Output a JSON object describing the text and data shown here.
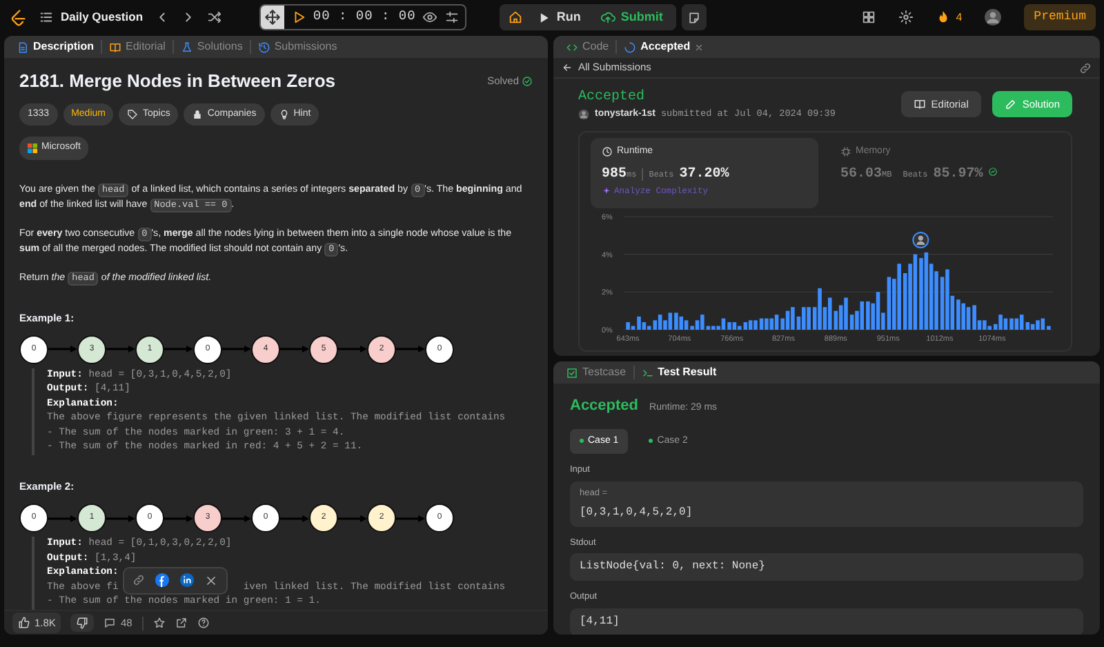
{
  "top_bar": {
    "title": "Daily Question",
    "timer": "00 : 00 : 00",
    "run": "Run",
    "submit": "Submit",
    "streak": "4",
    "premium": "Premium"
  },
  "problem": {
    "tabs": [
      {
        "label": "Description",
        "selected": true
      },
      {
        "label": "Editorial",
        "selected": false
      },
      {
        "label": "Solutions",
        "selected": false
      },
      {
        "label": "Submissions",
        "selected": false
      }
    ],
    "title": "2181. Merge Nodes in Between Zeros",
    "status": "Solved",
    "chips": [
      {
        "label": "1333",
        "kind": "plain"
      },
      {
        "label": "Medium",
        "kind": "difficulty"
      },
      {
        "label": "Topics",
        "kind": "tag"
      },
      {
        "label": "Companies",
        "kind": "lock"
      },
      {
        "label": "Hint",
        "kind": "bulb"
      }
    ],
    "company": "Microsoft",
    "paragraphs": [
      [
        {
          "kind": "plain",
          "text": "You are given the "
        },
        {
          "kind": "code",
          "text": "head"
        },
        {
          "kind": "plain",
          "text": " of a linked list, which contains a series of integers "
        },
        {
          "kind": "bold",
          "text": "separated"
        },
        {
          "kind": "plain",
          "text": " by "
        },
        {
          "kind": "code",
          "text": "0"
        },
        {
          "kind": "plain",
          "text": "'s. The "
        },
        {
          "kind": "bold",
          "text": "beginning"
        },
        {
          "kind": "plain",
          "text": " and "
        },
        {
          "kind": "bold",
          "text": "end"
        },
        {
          "kind": "plain",
          "text": " of the linked list will have "
        },
        {
          "kind": "code",
          "text": "Node.val == 0"
        },
        {
          "kind": "plain",
          "text": "."
        }
      ],
      [
        {
          "kind": "plain",
          "text": "For "
        },
        {
          "kind": "bold",
          "text": "every"
        },
        {
          "kind": "plain",
          "text": " two consecutive "
        },
        {
          "kind": "code",
          "text": "0"
        },
        {
          "kind": "plain",
          "text": "'s, "
        },
        {
          "kind": "bold",
          "text": "merge"
        },
        {
          "kind": "plain",
          "text": " all the nodes lying in between them into a single node whose value is the "
        },
        {
          "kind": "bold",
          "text": "sum"
        },
        {
          "kind": "plain",
          "text": " of all the merged nodes. The modified list should not contain any "
        },
        {
          "kind": "code",
          "text": "0"
        },
        {
          "kind": "plain",
          "text": "'s."
        }
      ],
      [
        {
          "kind": "plain",
          "text": "Return "
        },
        {
          "kind": "italic",
          "text": "the "
        },
        {
          "kind": "code",
          "text": "head"
        },
        {
          "kind": "italic",
          "text": " of the modified linked list."
        }
      ]
    ],
    "examples": [
      {
        "title": "Example 1:",
        "nodes": [
          {
            "value": "0",
            "color": "#ffffff"
          },
          {
            "value": "3",
            "color": "#d5e8d4"
          },
          {
            "value": "1",
            "color": "#d5e8d4"
          },
          {
            "value": "0",
            "color": "#ffffff"
          },
          {
            "value": "4",
            "color": "#f8cecc"
          },
          {
            "value": "5",
            "color": "#f8cecc"
          },
          {
            "value": "2",
            "color": "#f8cecc"
          },
          {
            "value": "0",
            "color": "#ffffff"
          }
        ],
        "io": [
          {
            "label": "Input:",
            "value": "head = [0,3,1,0,4,5,2,0]"
          },
          {
            "label": "Output:",
            "value": "[4,11]"
          }
        ],
        "explanation_label": "Explanation:",
        "explanation": [
          [
            "The above figure represents the given linked list. The modified list contains"
          ],
          [
            "- The sum of the nodes marked in green: 3 + 1 = 4."
          ],
          [
            "- The sum of the nodes marked in red: 4 + 5 + 2 = 11."
          ]
        ]
      },
      {
        "title": "Example 2:",
        "nodes": [
          {
            "value": "0",
            "color": "#ffffff"
          },
          {
            "value": "1",
            "color": "#d5e8d4"
          },
          {
            "value": "0",
            "color": "#ffffff"
          },
          {
            "value": "3",
            "color": "#f8cecc"
          },
          {
            "value": "0",
            "color": "#ffffff"
          },
          {
            "value": "2",
            "color": "#fff2cc"
          },
          {
            "value": "2",
            "color": "#fff2cc"
          },
          {
            "value": "0",
            "color": "#ffffff"
          }
        ],
        "io": [
          {
            "label": "Input:",
            "value": "head = [0,1,0,3,0,2,2,0]"
          },
          {
            "label": "Output:",
            "value": "[1,3,4]"
          }
        ],
        "explanation_label": "Explanation:",
        "explanation": [
          [
            "The above fi",
            "iven linked list. The modified list contains"
          ],
          [
            "- The sum of the nodes marked in green: 1 = 1."
          ]
        ]
      }
    ],
    "footer": {
      "likes": "1.8K",
      "comments": "48"
    }
  },
  "submission": {
    "tabs": [
      {
        "label": "Code",
        "selected": false,
        "closable": false
      },
      {
        "label": "Accepted",
        "selected": true,
        "closable": true
      }
    ],
    "back_link": "All Submissions",
    "status": "Accepted",
    "user": "tonystark-1st",
    "submitted": "submitted at Jul 04, 2024 09:39",
    "buttons": [
      {
        "label": "Editorial",
        "kind": "secondary"
      },
      {
        "label": "Solution",
        "kind": "primary"
      }
    ],
    "stats": [
      {
        "title": "Runtime",
        "selected": true,
        "value": "985",
        "unit": "ms",
        "beats_label": "Beats",
        "beats": "37.20%",
        "badge": false,
        "extra": "Analyze Complexity"
      },
      {
        "title": "Memory",
        "selected": false,
        "value": "56.03",
        "unit": "MB",
        "beats_label": "Beats",
        "beats": "85.97%",
        "badge": true
      }
    ],
    "chart_data": {
      "type": "bar",
      "ylim": [
        0,
        6
      ],
      "xlim": [
        638,
        1146
      ],
      "yticks": [
        {
          "value": 0,
          "label": "0%"
        },
        {
          "value": 2,
          "label": "2%"
        },
        {
          "value": 4,
          "label": "4%"
        },
        {
          "value": 6,
          "label": "6%"
        }
      ],
      "xticks": [
        {
          "value": 643,
          "label": "643ms"
        },
        {
          "value": 704,
          "label": "704ms"
        },
        {
          "value": 766,
          "label": "766ms"
        },
        {
          "value": 827,
          "label": "827ms"
        },
        {
          "value": 889,
          "label": "889ms"
        },
        {
          "value": 951,
          "label": "951ms"
        },
        {
          "value": 1012,
          "label": "1012ms"
        },
        {
          "value": 1074,
          "label": "1074ms"
        }
      ],
      "x": [
        643,
        649,
        656,
        662,
        668,
        675,
        681,
        687,
        693,
        700,
        706,
        712,
        719,
        725,
        731,
        738,
        744,
        750,
        756,
        763,
        769,
        775,
        782,
        788,
        794,
        801,
        807,
        813,
        819,
        826,
        832,
        838,
        845,
        851,
        857,
        864,
        870,
        876,
        882,
        889,
        895,
        901,
        908,
        914,
        920,
        927,
        933,
        939,
        945,
        952,
        958,
        964,
        971,
        977,
        983,
        990,
        996,
        1002,
        1008,
        1015,
        1021,
        1027,
        1034,
        1040,
        1046,
        1053,
        1059,
        1065,
        1071,
        1078,
        1084,
        1090,
        1097,
        1103,
        1109,
        1116,
        1122,
        1128,
        1134,
        1141
      ],
      "values": [
        0.4,
        0.2,
        0.7,
        0.4,
        0.2,
        0.5,
        0.8,
        0.5,
        0.9,
        0.9,
        0.7,
        0.5,
        0.2,
        0.5,
        0.8,
        0.2,
        0.2,
        0.2,
        0.6,
        0.4,
        0.4,
        0.2,
        0.4,
        0.5,
        0.5,
        0.6,
        0.6,
        0.6,
        0.8,
        0.6,
        1.0,
        1.2,
        0.7,
        1.2,
        1.2,
        1.2,
        2.2,
        1.2,
        1.7,
        1.0,
        1.3,
        1.7,
        0.8,
        1.0,
        1.5,
        1.5,
        1.4,
        2.0,
        0.9,
        2.8,
        2.7,
        3.5,
        3.0,
        3.5,
        4.0,
        3.8,
        4.1,
        3.5,
        3.1,
        2.8,
        3.2,
        1.8,
        1.6,
        1.4,
        1.2,
        1.3,
        0.5,
        0.5,
        0.2,
        0.3,
        0.8,
        0.6,
        0.6,
        0.6,
        0.8,
        0.4,
        0.3,
        0.5,
        0.6,
        0.2
      ]
    }
  },
  "result": {
    "tabs": [
      {
        "label": "Testcase",
        "selected": false
      },
      {
        "label": "Test Result",
        "selected": true
      }
    ],
    "status": "Accepted",
    "runtime": "Runtime: 29 ms",
    "cases": [
      {
        "label": "Case 1",
        "selected": true,
        "passed": true
      },
      {
        "label": "Case 2",
        "selected": false,
        "passed": true
      }
    ],
    "sections": [
      {
        "label": "Input",
        "var": "head =",
        "value": "[0,3,1,0,4,5,2,0]"
      },
      {
        "label": "Stdout",
        "value": "ListNode{val: 0, next: None}"
      },
      {
        "label": "Output",
        "value": "[4,11]"
      }
    ]
  }
}
